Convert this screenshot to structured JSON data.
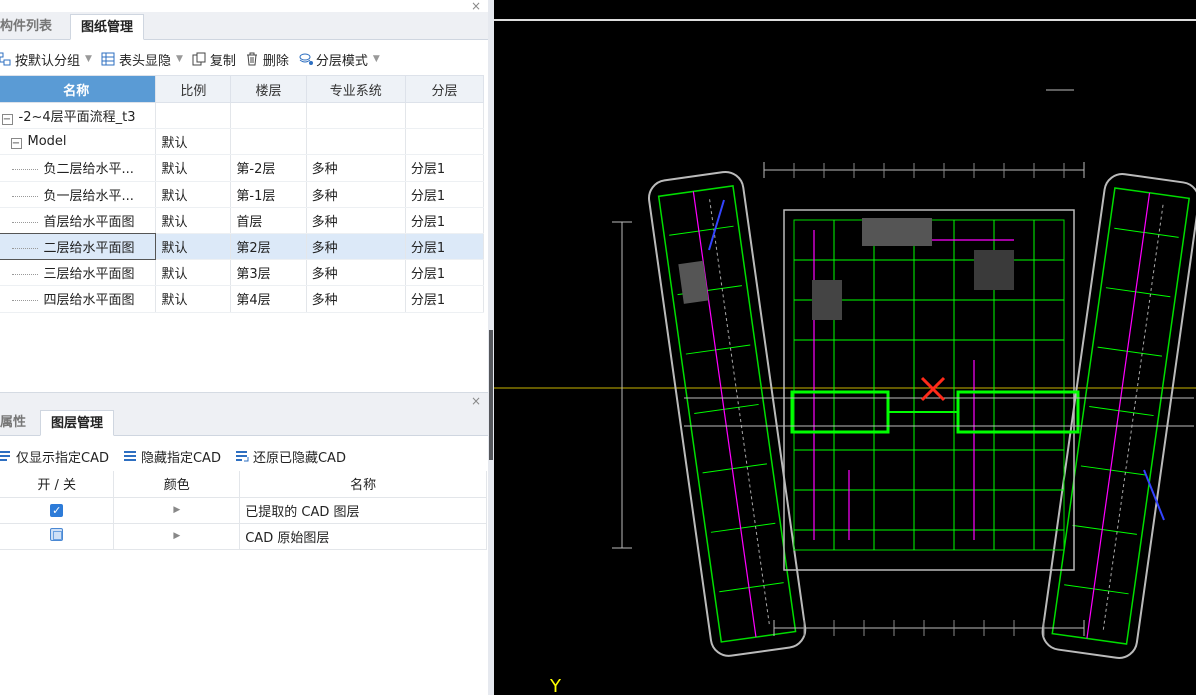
{
  "top_panel": {
    "tabs": [
      {
        "label": "构件列表",
        "active": false
      },
      {
        "label": "图纸管理",
        "active": true
      }
    ],
    "toolbar": {
      "group": "按默认分组",
      "header_toggle": "表头显隐",
      "copy": "复制",
      "delete": "删除",
      "layer_mode": "分层模式"
    },
    "columns": [
      "名称",
      "比例",
      "楼层",
      "专业系统",
      "分层"
    ],
    "root_row": {
      "name": "-2~4层平面流程_t3"
    },
    "model_row": {
      "name": "Model",
      "scale": "默认"
    },
    "rows": [
      {
        "name": "负二层给水平...",
        "scale": "默认",
        "floor": "第-2层",
        "system": "多种",
        "layer": "分层1",
        "selected": false
      },
      {
        "name": "负一层给水平...",
        "scale": "默认",
        "floor": "第-1层",
        "system": "多种",
        "layer": "分层1",
        "selected": false
      },
      {
        "name": "首层给水平面图",
        "scale": "默认",
        "floor": "首层",
        "system": "多种",
        "layer": "分层1",
        "selected": false
      },
      {
        "name": "二层给水平面图",
        "scale": "默认",
        "floor": "第2层",
        "system": "多种",
        "layer": "分层1",
        "selected": true
      },
      {
        "name": "三层给水平面图",
        "scale": "默认",
        "floor": "第3层",
        "system": "多种",
        "layer": "分层1",
        "selected": false
      },
      {
        "name": "四层给水平面图",
        "scale": "默认",
        "floor": "第4层",
        "system": "多种",
        "layer": "分层1",
        "selected": false
      }
    ]
  },
  "bottom_panel": {
    "tabs": [
      {
        "label": "属性",
        "active": false
      },
      {
        "label": "图层管理",
        "active": true
      }
    ],
    "toolbar": {
      "show_only": "仅显示指定CAD",
      "hide": "隐藏指定CAD",
      "restore": "还原已隐藏CAD"
    },
    "columns": [
      "开 / 关",
      "颜色",
      "名称"
    ],
    "layers": [
      {
        "checked": true,
        "name": "已提取的 CAD 图层"
      },
      {
        "checked": false,
        "name": "CAD 原始图层"
      }
    ]
  },
  "canvas": {
    "background": "#000000",
    "axis_label": "Y"
  },
  "colors": {
    "header_blue": "#5a9bd5",
    "selected_row": "#dce9f8",
    "cad_green": "#00ff00",
    "cad_magenta": "#ff00ff",
    "cad_red_cross": "#ff2a1a"
  }
}
